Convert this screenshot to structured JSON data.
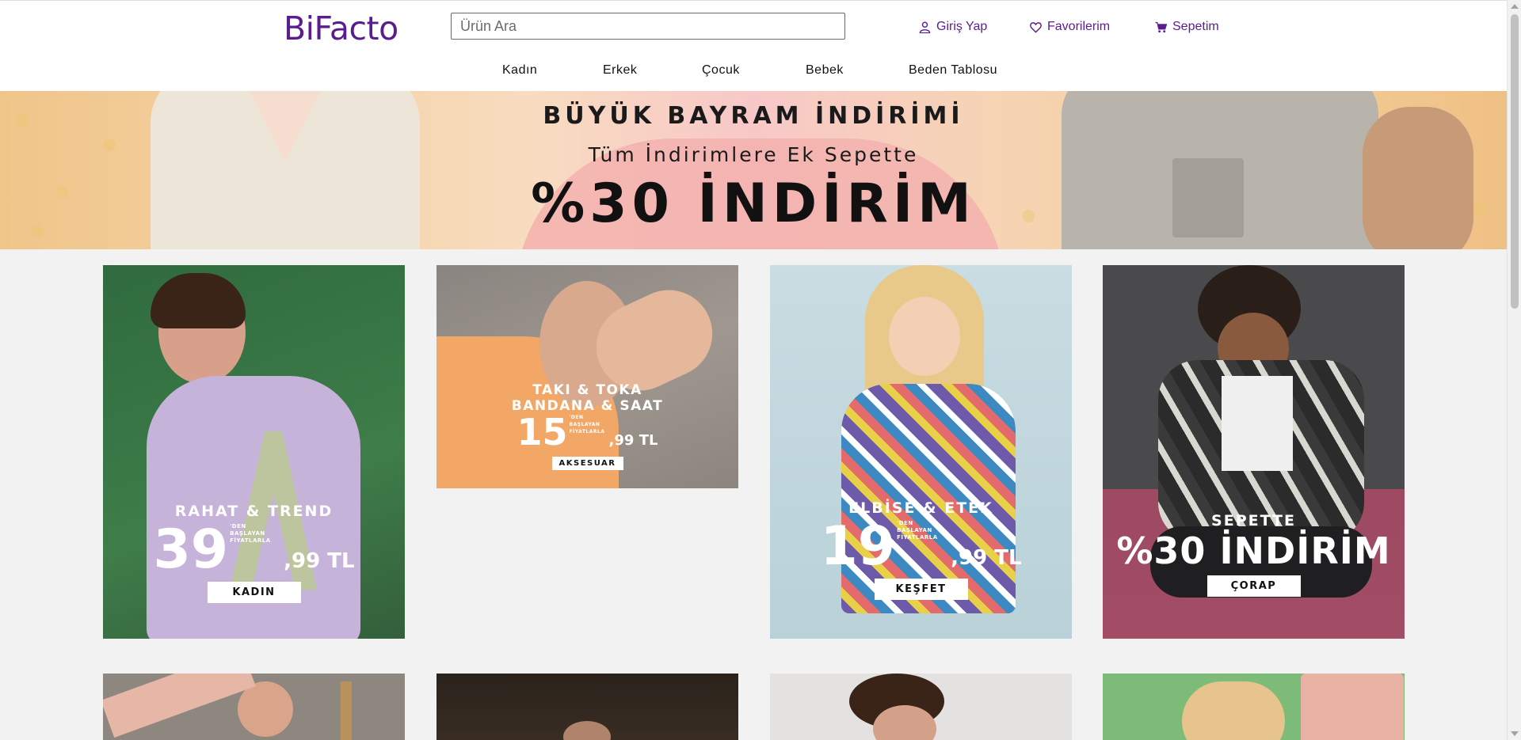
{
  "header": {
    "logo": "BiFacto",
    "search_placeholder": "Ürün Ara",
    "login_label": "Giriş Yap",
    "favorites_label": "Favorilerim",
    "cart_label": "Sepetim",
    "accent_color": "#5a1d8f"
  },
  "nav": [
    "Kadın",
    "Erkek",
    "Çocuk",
    "Bebek",
    "Beden Tablosu"
  ],
  "hero": {
    "line1": "BÜYÜK BAYRAM İNDİRİMİ",
    "line2": "Tüm İndirimlere Ek Sepette",
    "line3": "%30 İNDİRİM"
  },
  "cards": [
    {
      "heading": "RAHAT & TREND",
      "price_main": "39",
      "price_cents": ",99 TL",
      "price_note": "'DEN BAŞLAYAN FİYATLARLA",
      "button": "KADIN"
    },
    {
      "heading_1": "TAKI & TOKA",
      "heading_2": "BANDANA & SAAT",
      "price_main": "15",
      "price_cents": ",99 TL",
      "price_note": "'DEN BAŞLAYAN FİYATLARLA",
      "button": "AKSESUAR"
    },
    {
      "heading": "ELBİSE & ETEK",
      "price_main": "19",
      "price_cents": ",99 TL",
      "price_note": "'DEN BAŞLAYAN FİYATLARLA",
      "button": "KEŞFET"
    },
    {
      "heading": "SEPETTE",
      "headline": "%30 İNDİRİM",
      "button": "ÇORAP"
    }
  ]
}
